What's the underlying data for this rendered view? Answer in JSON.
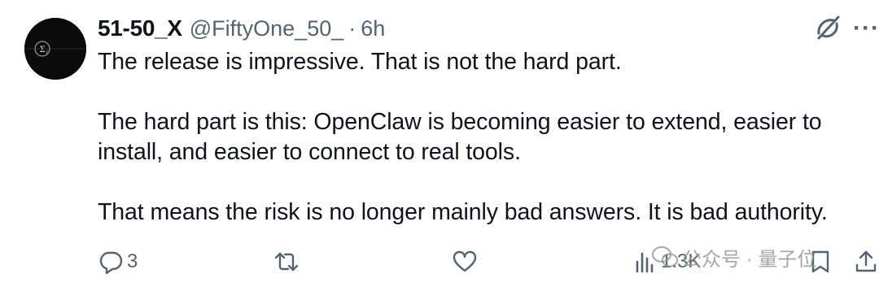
{
  "tweet": {
    "author": {
      "display_name": "51-50_X",
      "handle": "@FiftyOne_50_",
      "separator": "·",
      "time": "6h",
      "avatar_icon": "sigma-icon"
    },
    "paragraphs": [
      "The release is impressive. That is not the hard part.",
      "The hard part is this: OpenClaw is becoming easier to extend, easier to install, and easier to connect to real tools.",
      "That means the risk is no longer mainly bad answers. It is bad authority."
    ],
    "top_actions": {
      "grok_icon": "grok-icon",
      "more_label": "···"
    },
    "actions": {
      "reply_count": "3",
      "retweet_count": "",
      "like_count": "",
      "views_count": "1.3K"
    }
  },
  "watermark": {
    "text": "公众号 · 量子位"
  },
  "colors": {
    "text_primary": "#0f1419",
    "text_secondary": "#536471",
    "background": "#ffffff"
  }
}
